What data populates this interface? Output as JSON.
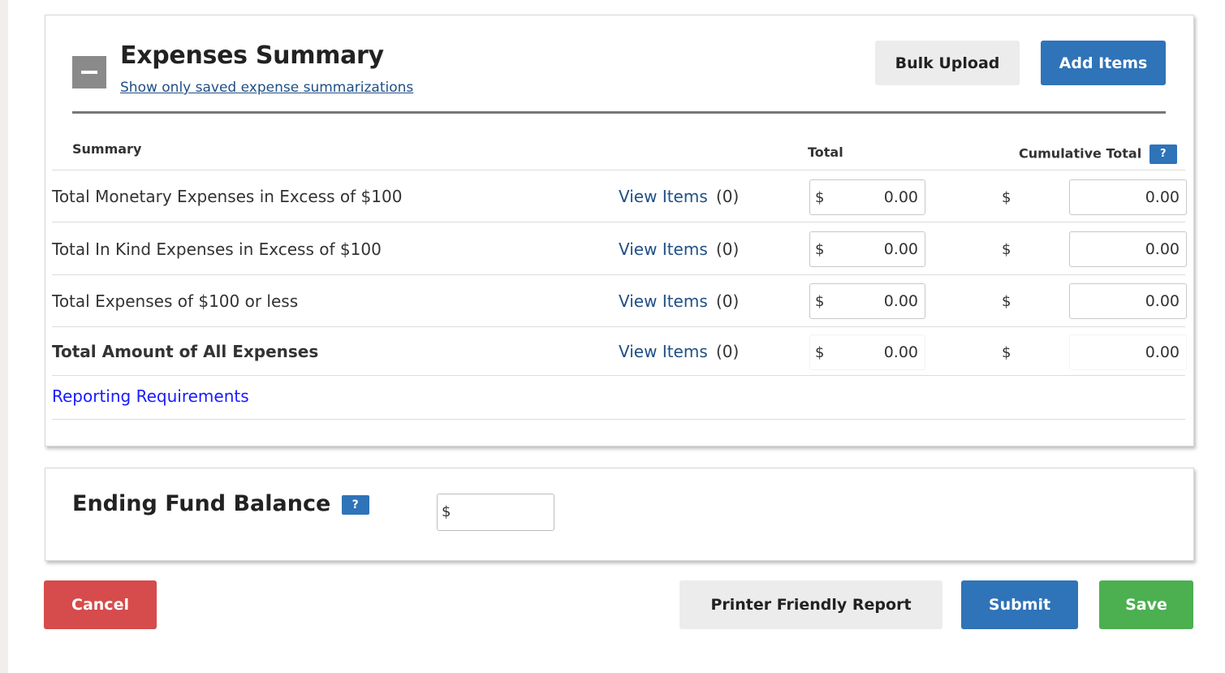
{
  "section": {
    "title": "Expenses Summary",
    "subtitle_link": "Show only saved expense summarizations",
    "bulk_upload": "Bulk Upload",
    "add_items": "Add Items"
  },
  "columns": {
    "summary": "Summary",
    "total": "Total",
    "cumulative_total": "Cumulative Total",
    "help_icon": "?"
  },
  "rows": [
    {
      "label": "Total Monetary Expenses in Excess of $100",
      "view_items": "View Items",
      "count": "(0)",
      "currency": "$",
      "total": "0.00",
      "cumulative": "0.00"
    },
    {
      "label": "Total In Kind Expenses in Excess of $100",
      "view_items": "View Items",
      "count": "(0)",
      "currency": "$",
      "total": "0.00",
      "cumulative": "0.00"
    },
    {
      "label": "Total Expenses of $100 or less",
      "view_items": "View Items",
      "count": "(0)",
      "currency": "$",
      "total": "0.00",
      "cumulative": "0.00"
    },
    {
      "label": "Total Amount of All Expenses",
      "view_items": "View Items",
      "count": "(0)",
      "currency": "$",
      "total": "0.00",
      "cumulative": "0.00"
    }
  ],
  "reporting_link": "Reporting Requirements",
  "fund": {
    "title": "Ending Fund Balance",
    "help_icon": "?",
    "currency": "$",
    "value": ""
  },
  "actions": {
    "cancel": "Cancel",
    "printer": "Printer Friendly Report",
    "submit": "Submit",
    "save": "Save"
  },
  "colors": {
    "primary": "#2f73b8",
    "danger": "#d64b4b",
    "success": "#4caf50",
    "link": "#1f4f86"
  }
}
